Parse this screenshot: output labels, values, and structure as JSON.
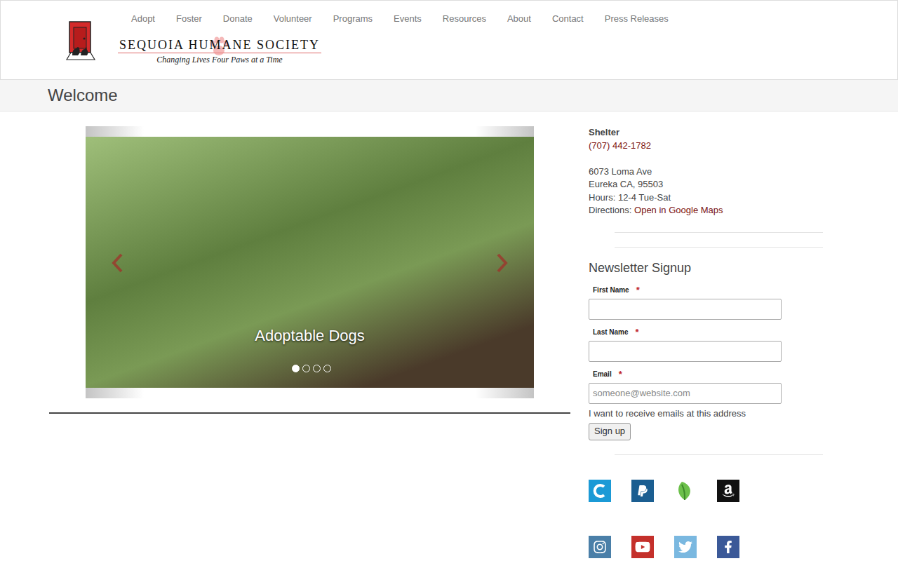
{
  "header": {
    "logo": {
      "name": "SEQUOIA HUMANE SOCIETY",
      "tagline": "Changing Lives Four Paws at a Time"
    },
    "nav": [
      "Adopt",
      "Foster",
      "Donate",
      "Volunteer",
      "Programs",
      "Events",
      "Resources",
      "About",
      "Contact",
      "Press Releases"
    ]
  },
  "page_title": "Welcome",
  "carousel": {
    "caption": "Adoptable Dogs",
    "slides": [
      {
        "selected": true
      },
      {
        "selected": false
      },
      {
        "selected": false
      },
      {
        "selected": false
      }
    ]
  },
  "shelter": {
    "title": "Shelter",
    "phone": "(707) 442-1782",
    "address": [
      "6073 Loma Ave",
      "Eureka CA, 95503",
      "Hours: 12-4 Tue-Sat"
    ],
    "directions": {
      "label": "Directions:",
      "link": "Open in Google Maps"
    }
  },
  "newsletter": {
    "title": "Newsletter Signup",
    "required_mark": "*",
    "fields": [
      {
        "label": "First Name",
        "required": true,
        "placeholder": ""
      },
      {
        "label": "Last Name",
        "required": true,
        "placeholder": ""
      },
      {
        "label": "Email",
        "required": true,
        "placeholder": "someone@website.com"
      }
    ],
    "consent": "I want to receive emails at this address",
    "button": "Sign up"
  }
}
